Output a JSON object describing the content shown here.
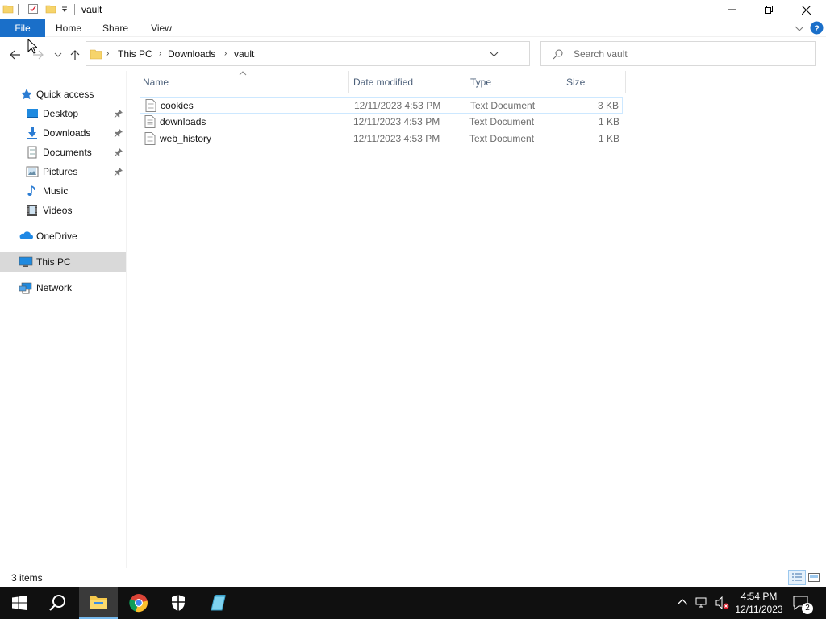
{
  "window": {
    "title": "vault"
  },
  "ribbon": {
    "tabs": [
      "File",
      "Home",
      "Share",
      "View"
    ]
  },
  "address": {
    "crumbs": [
      "This PC",
      "Downloads",
      "vault"
    ]
  },
  "search": {
    "placeholder": "Search vault"
  },
  "sidebar": {
    "items": [
      {
        "label": "Quick access",
        "icon": "star-icon"
      },
      {
        "label": "Desktop",
        "icon": "desktop-icon",
        "pinned": true
      },
      {
        "label": "Downloads",
        "icon": "download-arrow-icon",
        "pinned": true
      },
      {
        "label": "Documents",
        "icon": "documents-icon",
        "pinned": true
      },
      {
        "label": "Pictures",
        "icon": "pictures-icon",
        "pinned": true
      },
      {
        "label": "Music",
        "icon": "music-note-icon"
      },
      {
        "label": "Videos",
        "icon": "film-icon"
      },
      {
        "label": "OneDrive",
        "icon": "cloud-icon"
      },
      {
        "label": "This PC",
        "icon": "computer-icon",
        "selected": true
      },
      {
        "label": "Network",
        "icon": "network-icon"
      }
    ]
  },
  "list": {
    "columns": [
      "Name",
      "Date modified",
      "Type",
      "Size"
    ],
    "rows": [
      {
        "name": "cookies",
        "date": "12/11/2023 4:53 PM",
        "type": "Text Document",
        "size": "3 KB"
      },
      {
        "name": "downloads",
        "date": "12/11/2023 4:53 PM",
        "type": "Text Document",
        "size": "1 KB"
      },
      {
        "name": "web_history",
        "date": "12/11/2023 4:53 PM",
        "type": "Text Document",
        "size": "1 KB"
      }
    ]
  },
  "status": {
    "item_count": "3 items"
  },
  "taskbar": {
    "time": "4:54 PM",
    "date": "12/11/2023",
    "notification_count": "2"
  },
  "colors": {
    "file_tab": "#1a6fc9",
    "selection_border": "#cde8ff",
    "sidebar_selected": "#d9d9d9",
    "taskbar": "#101010"
  }
}
